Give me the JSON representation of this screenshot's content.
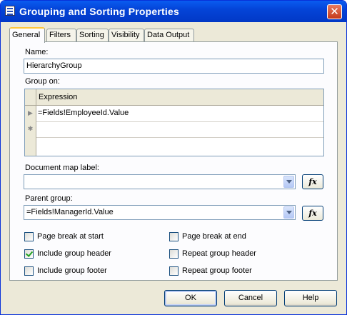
{
  "window": {
    "title": "Grouping and Sorting Properties",
    "close_glyph": "✕"
  },
  "tabs": [
    {
      "label": "General",
      "active": true
    },
    {
      "label": "Filters",
      "active": false
    },
    {
      "label": "Sorting",
      "active": false
    },
    {
      "label": "Visibility",
      "active": false
    },
    {
      "label": "Data Output",
      "active": false
    }
  ],
  "general": {
    "name_label": "Name:",
    "name_value": "HierarchyGroup",
    "group_on_label": "Group on:",
    "grid": {
      "column_header": "Expression",
      "rows": [
        {
          "selector_glyph": "▶",
          "value": "=Fields!EmployeeId.Value"
        }
      ],
      "new_row_glyph": "✱"
    },
    "doc_map_label": "Document map label:",
    "doc_map_value": "",
    "parent_group_label": "Parent group:",
    "parent_group_value": "=Fields!ManagerId.Value",
    "fx_label": "fx"
  },
  "checkboxes": {
    "page_break_start": {
      "label": "Page break at start",
      "checked": false
    },
    "page_break_end": {
      "label": "Page break at end",
      "checked": false
    },
    "include_group_header": {
      "label": "Include group header",
      "checked": true
    },
    "repeat_group_header": {
      "label": "Repeat group header",
      "checked": false
    },
    "include_group_footer": {
      "label": "Include group footer",
      "checked": false
    },
    "repeat_group_footer": {
      "label": "Repeat group footer",
      "checked": false
    }
  },
  "buttons": {
    "ok": "OK",
    "cancel": "Cancel",
    "help": "Help"
  },
  "colors": {
    "title_bar": "#0444d8",
    "dialog_bg": "#ece9d8",
    "active_tab_accent": "#ffc73c",
    "close_button": "#c5391a"
  }
}
